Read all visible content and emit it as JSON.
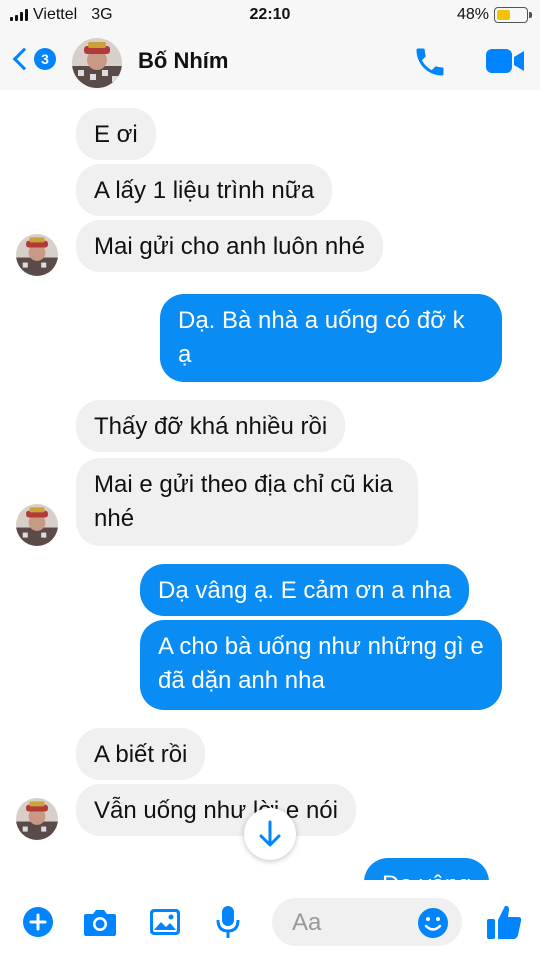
{
  "status": {
    "carrier": "Viettel",
    "network": "3G",
    "time": "22:10",
    "battery": "48%",
    "battery_level": 0.48
  },
  "header": {
    "unread_count": "3",
    "contact_name": "Bố Nhím",
    "accent_color": "#0084ff"
  },
  "messages": [
    {
      "side": "in",
      "text": "E ơi"
    },
    {
      "side": "in",
      "text": "A lấy 1 liệu trình nữa"
    },
    {
      "side": "in",
      "text": "Mai gửi cho anh luôn nhé"
    },
    {
      "side": "out",
      "text": "Dạ. Bà nhà a uống có đỡ k ạ"
    },
    {
      "side": "in",
      "text": "Thấy đỡ khá nhiều rồi"
    },
    {
      "side": "in",
      "text": "Mai e gửi theo địa chỉ cũ kia nhé"
    },
    {
      "side": "out",
      "text": "Dạ vâng ạ. E cảm ơn a nha"
    },
    {
      "side": "out",
      "text": "A cho bà uống như những gì e đã dặn anh nha"
    },
    {
      "side": "in",
      "text": "A biết rồi"
    },
    {
      "side": "in",
      "text": "Vẫn uống như lời e nói"
    },
    {
      "side": "out",
      "text": "Dạ vâng"
    }
  ],
  "composer": {
    "placeholder": "Aa"
  },
  "icons": [
    "back-chevron-icon",
    "phone-icon",
    "video-camera-icon",
    "add-icon",
    "camera-icon",
    "gallery-icon",
    "microphone-icon",
    "emoji-icon",
    "thumbs-up-icon",
    "arrow-down-icon"
  ]
}
